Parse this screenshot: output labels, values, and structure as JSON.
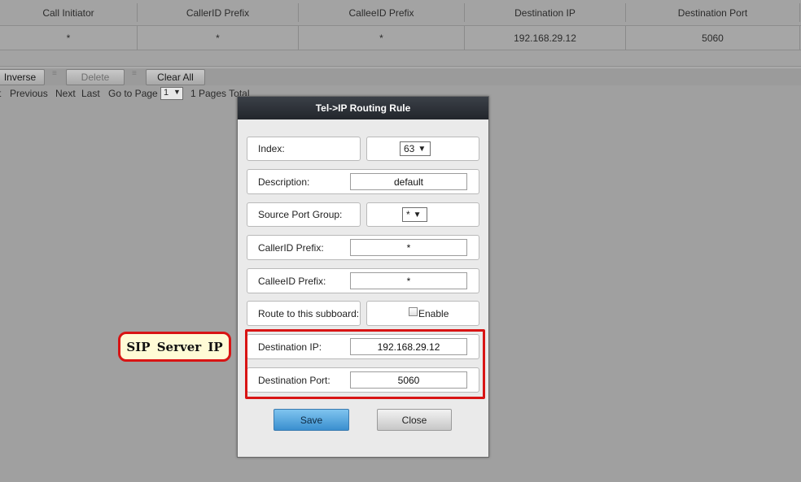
{
  "table": {
    "columns": [
      "Call Initiator",
      "CallerID Prefix",
      "CalleeID Prefix",
      "Destination IP",
      "Destination Port"
    ],
    "rows": [
      [
        "*",
        "*",
        "*",
        "192.168.29.12",
        "5060"
      ]
    ]
  },
  "toolbar": {
    "inverse_label": "Inverse",
    "delete_label": "Delete",
    "clear_all_label": "Clear All"
  },
  "pager": {
    "previous": "Previous",
    "next": "Next",
    "last": "Last",
    "go_to_page": "Go to Page",
    "current_page": "1",
    "total": "1 Pages Total"
  },
  "dialog": {
    "title": "Tel->IP Routing Rule",
    "index_label": "Index:",
    "index_value": "63",
    "description_label": "Description:",
    "description_value": "default",
    "source_port_group_label": "Source Port Group:",
    "source_port_group_value": "*",
    "callerid_prefix_label": "CallerID Prefix:",
    "callerid_prefix_value": "*",
    "calleeid_prefix_label": "CalleeID Prefix:",
    "calleeid_prefix_value": "*",
    "route_label": "Route to this subboard:",
    "route_enable_label": "Enable",
    "destination_ip_label": "Destination IP:",
    "destination_ip_value": "192.168.29.12",
    "destination_port_label": "Destination Port:",
    "destination_port_value": "5060",
    "save_label": "Save",
    "close_label": "Close"
  },
  "annotation": {
    "callout_text": "SIP Server IP",
    "highlight_color": "#d81414"
  },
  "colors": {
    "accent_button": "#3a8fcf",
    "title_bar": "#22262c"
  }
}
